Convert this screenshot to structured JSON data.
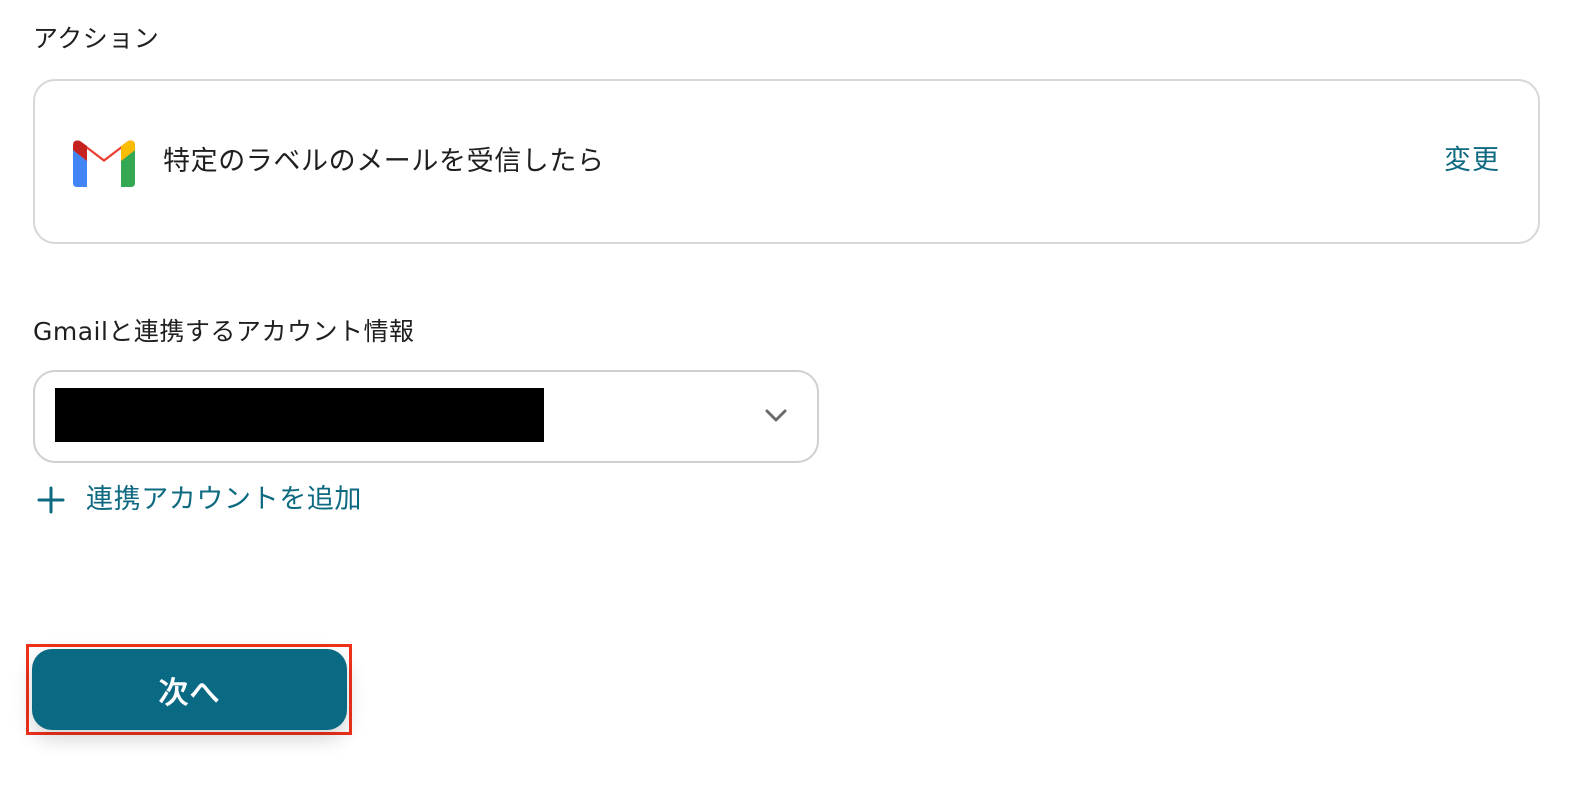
{
  "section": {
    "action_label": "アクション",
    "account_label": "Gmailと連携するアカウント情報"
  },
  "action_card": {
    "title": "特定のラベルのメールを受信したら",
    "change_label": "変更",
    "icon": "gmail-icon"
  },
  "account_select": {
    "selected_value": "",
    "redacted": true,
    "icon": "chevron-down-icon"
  },
  "add_account": {
    "label": "連携アカウントを追加",
    "icon": "plus-icon"
  },
  "next_button": {
    "label": "次へ",
    "highlighted": true
  },
  "colors": {
    "accent": "#0e6a80",
    "button_bg": "#0b6a83",
    "highlight_border": "#f0311a",
    "border": "#d7d7d7"
  }
}
